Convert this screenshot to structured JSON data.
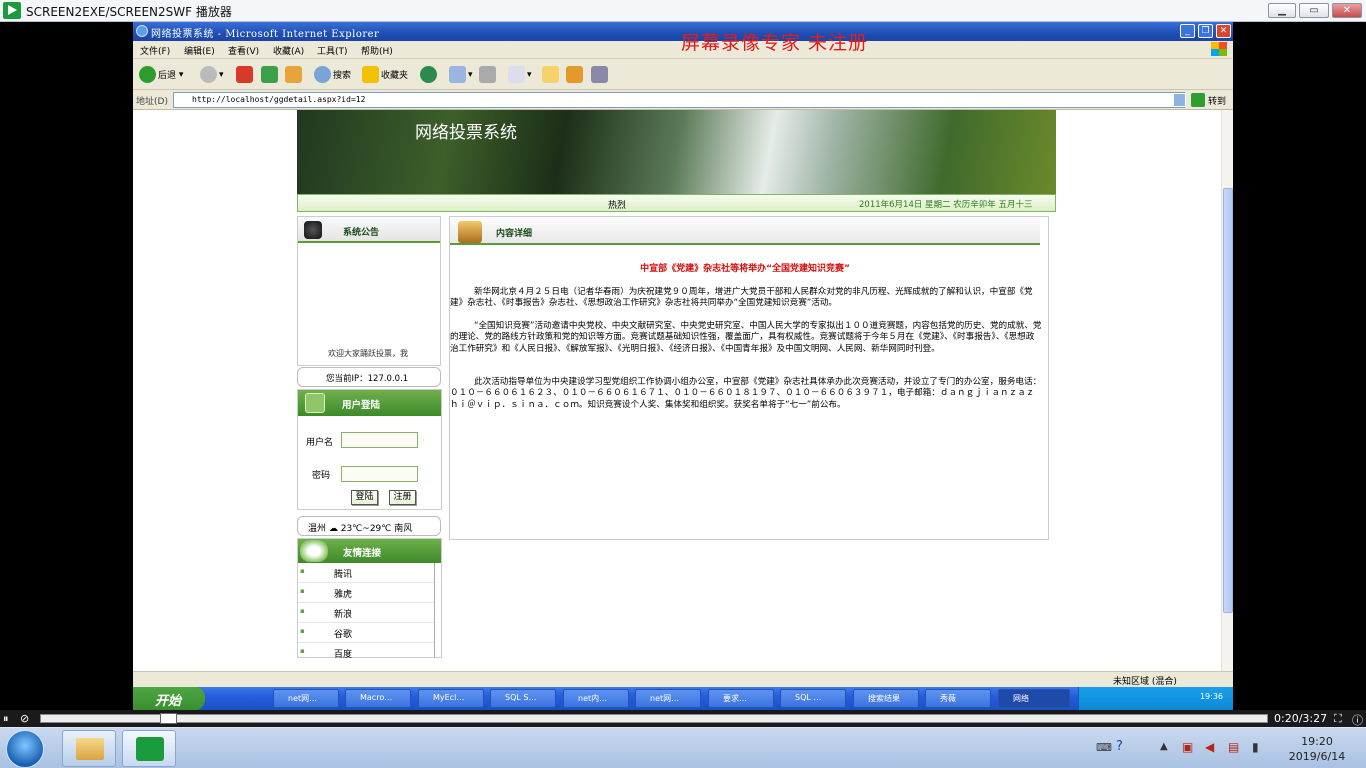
{
  "player": {
    "title": "SCREEN2EXE/SCREEN2SWF 播放器",
    "time": "0:20/3:27"
  },
  "ie": {
    "title": "网络投票系统 - Microsoft Internet Explorer",
    "watermark": "屏幕录像专家  未注册",
    "menu": [
      "文件(F)",
      "编辑(E)",
      "查看(V)",
      "收藏(A)",
      "工具(T)",
      "帮助(H)"
    ],
    "toolbar": {
      "back": "后退",
      "search": "搜索",
      "favorites": "收藏夹"
    },
    "address_label": "地址(D)",
    "address": "http://localhost/ggdetail.aspx?id=12",
    "go": "转到",
    "status_zone": "未知区域 (混合)"
  },
  "xp_taskbar": {
    "start": "开始",
    "tasks": [
      "net网…",
      "Macro…",
      "MyEcl…",
      "SQL S…",
      "net内…",
      "net网…",
      "要求…",
      "SQL …",
      "搜索结果",
      "秀薇",
      "网络"
    ],
    "clock": "19:36"
  },
  "page": {
    "banner_title": "网络投票系统",
    "hot_label": "热烈",
    "date_line": "2011年6月14日 星期二  农历辛卯年  五月十三",
    "notice_title": "系统公告",
    "notice_marquee": "欢迎大家踊跃投票，我",
    "ip_text": "您当前IP：127.0.0.1",
    "login_title": "用户登陆",
    "username_label": "用户名",
    "password_label": "密码",
    "login_button": "登陆",
    "register_button": "注册",
    "weather": "温州  ☁  23℃~29℃  南风",
    "links_title": "友情连接",
    "links": [
      "腾讯",
      "雅虎",
      "新浪",
      "谷歌",
      "百度"
    ],
    "content_title": "内容详细",
    "article_title": "中宣部《党建》杂志社等将举办“全国党建知识竞赛”",
    "paragraphs": [
      "新华网北京４月２５日电（记者华春雨）为庆祝建党９０周年，增进广大党员干部和人民群众对党的非凡历程、光辉成就的了解和认识，中宣部《党建》杂志社、《时事报告》杂志社、《思想政治工作研究》杂志社将共同举办“全国党建知识竞赛”活动。",
      "“全国知识竞赛”活动邀请中央党校、中央文献研究室、中央党史研究室、中国人民大学的专家拟出１００道竞赛题，内容包括党的历史、党的成就、党的理论、党的路线方针政策和党的知识等方面。竞赛试题基础知识性强，覆盖面广，具有权威性。竞赛试题将于今年５月在《党建》、《时事报告》、《思想政治工作研究》和《人民日报》、《解放军报》、《光明日报》、《经济日报》、《中国青年报》及中国文明网、人民网、新华网同时刊登。",
      "此次活动指导单位为中央建设学习型党组织工作协调小组办公室，中宣部《党建》杂志社具体承办此次竞赛活动，并设立了专门的办公室，服务电话：０１０－６６０６１６２３、０１０－６６０６１６７１、０１０－６６０１８１９７、０１０－６６０６３９７１，电子邮箱：ｄａｎｇｊｉａｎｚａｚｈｉ＠ｖｉｐ．ｓｉｎａ．ｃｏｍ。知识竞赛设个人奖、集体奖和组织奖。获奖名单将于“七一”前公布。"
    ]
  },
  "win7": {
    "time": "19:20",
    "date": "2019/6/14"
  }
}
